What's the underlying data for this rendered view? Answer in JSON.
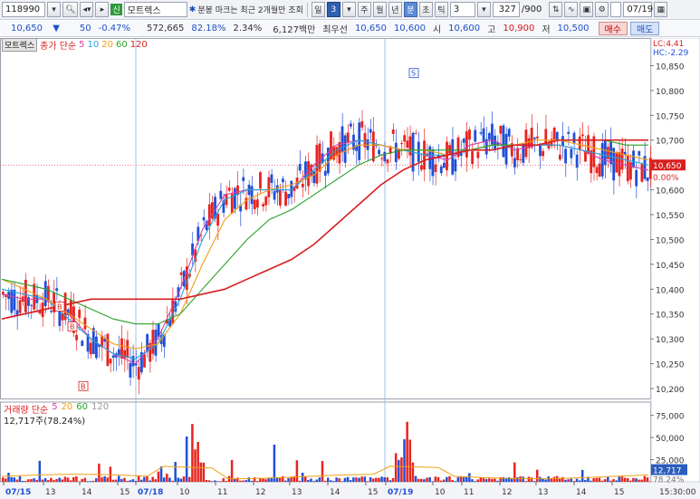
{
  "toolbar": {
    "code": "118990",
    "market_badge": "신",
    "name": "모트렉스",
    "notice": "분봉 마크는 최근 2개월만 조회",
    "periods": [
      "일",
      "3",
      "주",
      "월",
      "년",
      "분",
      "초",
      "틱"
    ],
    "tick_value": "3",
    "count": "327",
    "total": "/900",
    "date": "07/19"
  },
  "info": {
    "price": "10,650",
    "change": "50",
    "change_pct": "-0.47%",
    "volume": "572,665",
    "ratio": "82.18%",
    "rate2": "2.34%",
    "amount": "6,127백만",
    "best_ask_label": "최우선",
    "best_ask": "10,650",
    "best_bid": "10,600",
    "open_label": "시",
    "open": "10,600",
    "high_label": "고",
    "high": "10,900",
    "low_label": "저",
    "low": "10,500",
    "buy": "매수",
    "sell": "매도"
  },
  "legend": {
    "symbol": "모트렉스",
    "series_label": "종가 단순",
    "periods": [
      "5",
      "10",
      "20",
      "60",
      "120"
    ]
  },
  "volume_legend": {
    "label": "거래량 단순",
    "periods": [
      "5",
      "20",
      "60",
      "120"
    ],
    "value": "12,717주(78.24%)"
  },
  "colors": {
    "up": "#e8231e",
    "down": "#1f4fd8",
    "ma5": "#d63fa8",
    "ma10": "#27a3d8",
    "ma20": "#f0a010",
    "ma60": "#2aa02a",
    "ma120": "#d81e1e"
  },
  "chart_data": {
    "type": "candlestick",
    "price_axis": [
      "10,850",
      "10,800",
      "10,750",
      "10,700",
      "10,650",
      "10,600",
      "10,550",
      "10,500",
      "10,450",
      "10,400",
      "10,350",
      "10,300",
      "10,250",
      "10,200"
    ],
    "price_range": [
      10180,
      10880
    ],
    "current_price_tag": "10,650",
    "current_pct_tag": "0.00%",
    "lc": "LC:4.41",
    "hc": "HC:-2.29",
    "volume_axis": [
      "75,000",
      "50,000",
      "25,000"
    ],
    "volume_last": "12,717",
    "volume_last_pct": "78.24%",
    "x_labels": [
      "07/15",
      "13",
      "14",
      "15",
      "07/18",
      "10",
      "11",
      "12",
      "13",
      "14",
      "15",
      "07/19",
      "10",
      "11",
      "12",
      "13",
      "14",
      "15"
    ],
    "time_label": "15:30:00",
    "session_markers": [
      "S",
      "B",
      "B",
      "B"
    ],
    "ma_points": {
      "ma5": [
        10390,
        10380,
        10380,
        10350,
        10300,
        10270,
        10250,
        10300,
        10400,
        10520,
        10590,
        10600,
        10600,
        10600,
        10650,
        10690,
        10700,
        10690,
        10680,
        10670,
        10660,
        10690,
        10700,
        10680,
        10690,
        10690,
        10680,
        10660,
        10650,
        10640
      ],
      "ma10": [
        10400,
        10390,
        10380,
        10340,
        10300,
        10270,
        10260,
        10290,
        10380,
        10500,
        10580,
        10600,
        10600,
        10600,
        10640,
        10680,
        10700,
        10690,
        10680,
        10670,
        10670,
        10680,
        10690,
        10690,
        10690,
        10690,
        10680,
        10670,
        10660,
        10650
      ],
      "ma20": [
        10420,
        10400,
        10380,
        10350,
        10320,
        10290,
        10280,
        10290,
        10350,
        10450,
        10540,
        10580,
        10600,
        10610,
        10630,
        10670,
        10690,
        10690,
        10680,
        10680,
        10670,
        10680,
        10690,
        10690,
        10700,
        10700,
        10690,
        10680,
        10670,
        10660
      ],
      "ma60": [
        10420,
        10410,
        10400,
        10380,
        10360,
        10340,
        10330,
        10330,
        10350,
        10400,
        10450,
        10500,
        10540,
        10560,
        10590,
        10620,
        10650,
        10670,
        10680,
        10680,
        10680,
        10680,
        10690,
        10690,
        10690,
        10700,
        10700,
        10700,
        10690,
        10690
      ],
      "ma120": [
        10340,
        10350,
        10360,
        10370,
        10380,
        10380,
        10380,
        10380,
        10380,
        10390,
        10400,
        10420,
        10440,
        10460,
        10490,
        10530,
        10570,
        10610,
        10640,
        10660,
        10670,
        10680,
        10680,
        10690,
        10690,
        10700,
        10700,
        10700,
        10700,
        10700
      ]
    }
  }
}
